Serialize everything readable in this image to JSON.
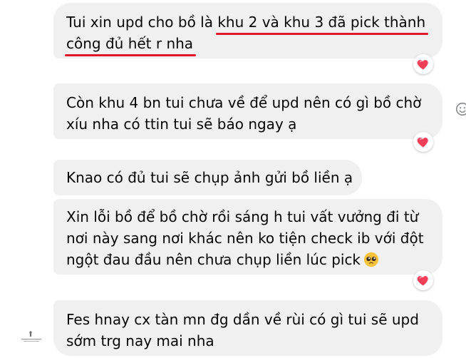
{
  "messages": [
    {
      "lines": [
        {
          "plain": "Tui xin upd cho bồ là ",
          "highlight": "khu 2 và khu 3 đã pick thành"
        },
        {
          "plain": "",
          "highlight": "công đủ hết r nha"
        }
      ],
      "reaction": "heart"
    },
    {
      "lines": [
        {
          "plain": "Còn khu 4 bn tui chưa về để upd nên có gì bồ chờ"
        },
        {
          "plain": "xíu nha có ttin tui sẽ báo ngay ạ"
        }
      ],
      "reaction": "heart"
    },
    {
      "lines": [
        {
          "plain": "Knao có đủ tui sẽ chụp ảnh gửi bồ liền ạ"
        }
      ]
    },
    {
      "lines": [
        {
          "plain": "Xin lỗi bồ để bồ chờ rồi sáng h tui vất vưởng đi từ"
        },
        {
          "plain": "nơi này sang nơi khác nên ko tiện check ib với đột"
        },
        {
          "plain": "ngột đau đầu nên chưa chụp liền lúc pick"
        }
      ],
      "trailing_emoji": "pleading-face-emoji",
      "reaction": "heart"
    },
    {
      "lines": [
        {
          "plain": "Fes hnay cx tàn mn đg dần về rùi có gì tui sẽ upd"
        },
        {
          "plain": "sớm trg nay mai nha"
        }
      ]
    }
  ],
  "colors": {
    "bubble_bg": "#f0f0f0",
    "text": "#050505",
    "underline": "#e0162b",
    "heart": "#f33e58"
  },
  "icons": {
    "reaction": "heart-icon",
    "side_action": "smiley-icon",
    "watermark": "watermark-logo"
  }
}
